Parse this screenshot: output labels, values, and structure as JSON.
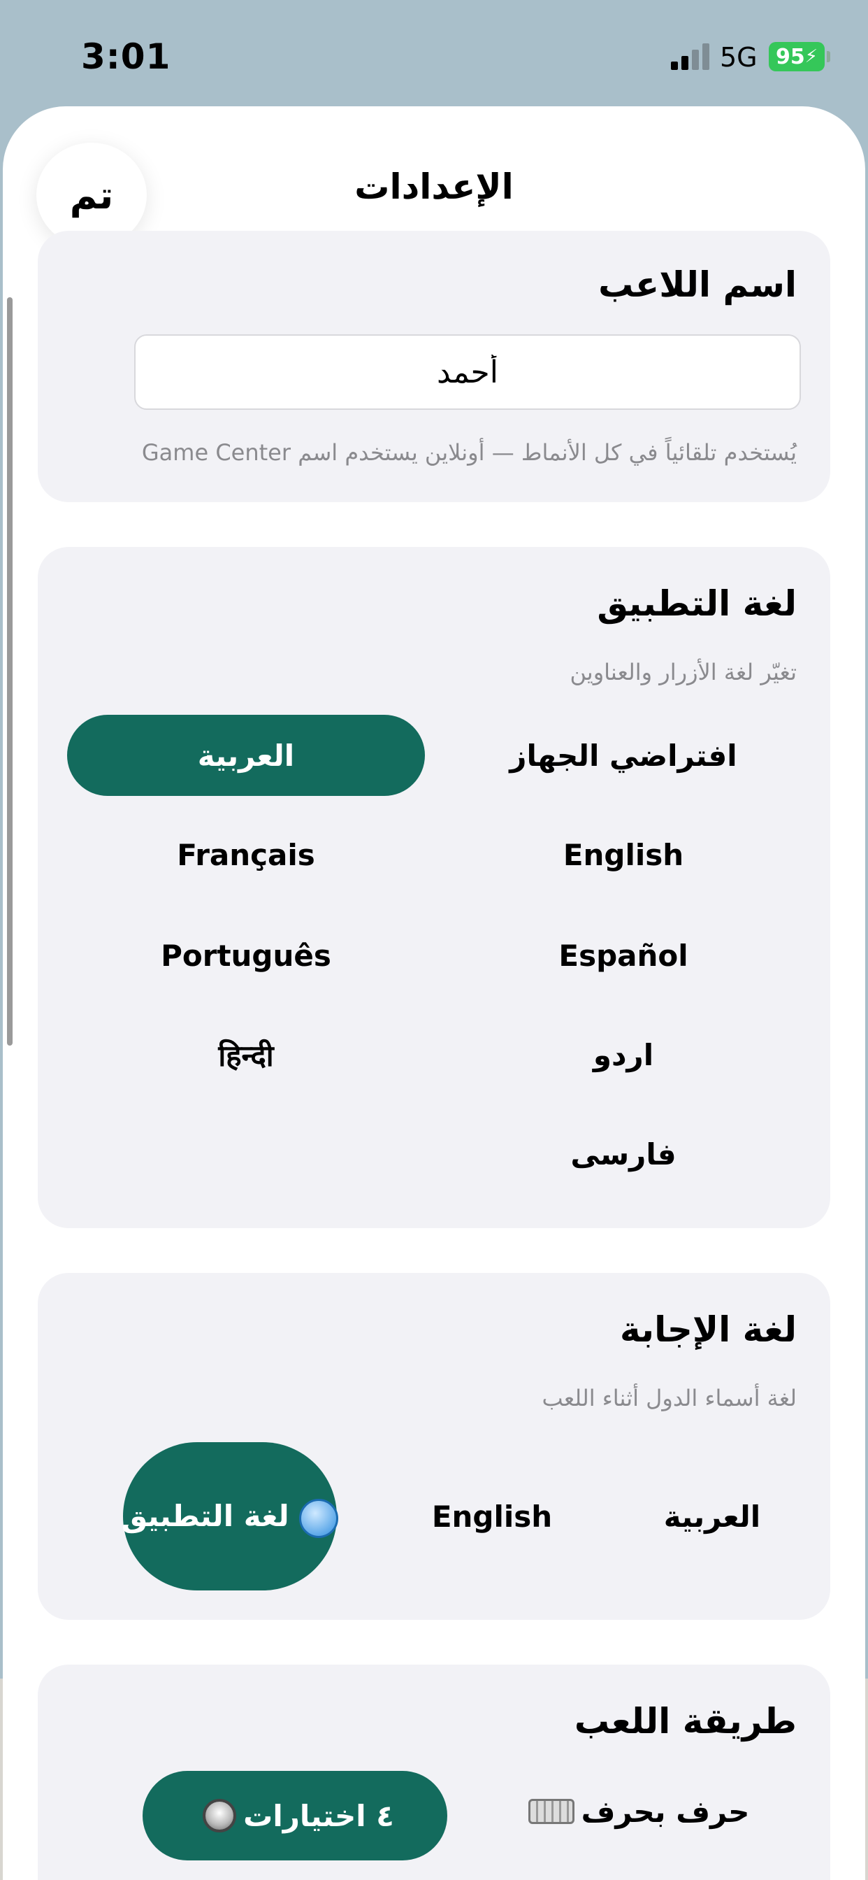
{
  "status_bar": {
    "time": "3:01",
    "network": "5G",
    "battery": "95"
  },
  "nav": {
    "done_label": "تم",
    "title": "الإعدادات"
  },
  "player_name": {
    "title": "اسم اللاعب",
    "value": "أحمد",
    "hint": "يُستخدم تلقائياً في كل الأنماط — أونلاين يستخدم اسم Game Center"
  },
  "app_language": {
    "title": "لغة التطبيق",
    "subtitle": "تغيّر لغة الأزرار والعناوين",
    "options": [
      "افتراضي الجهاز",
      "العربية",
      "English",
      "Français",
      "Español",
      "Português",
      "اردو",
      "हिन्दी",
      "فارسى"
    ],
    "selected": "العربية"
  },
  "answer_language": {
    "title": "لغة الإجابة",
    "subtitle": "لغة أسماء الدول أثناء اللعب",
    "options": [
      "العربية",
      "English",
      "لغة التطبيق"
    ],
    "app_option_icon": "globe-icon",
    "selected": "لغة التطبيق"
  },
  "play_mode": {
    "title": "طريقة اللعب",
    "options": [
      "حرف بحرف",
      "٤ اختيارات"
    ],
    "option_icons": [
      "keyboard-icon",
      "radio-button-icon"
    ],
    "selected": "٤ اختيارات"
  },
  "colors": {
    "accent": "#136b5d",
    "card_bg": "#f2f2f6",
    "status_bg": "#a9bfca",
    "battery": "#35c759"
  }
}
